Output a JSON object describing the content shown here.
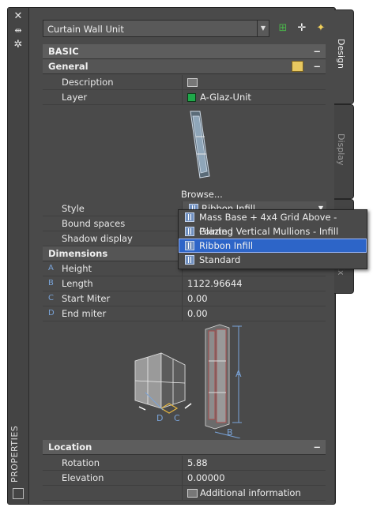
{
  "toolbar": {
    "selected_object": "Curtain Wall Unit"
  },
  "side": {
    "palette_title": "PROPERTIES"
  },
  "tabs": [
    "Design",
    "Display",
    "Ex"
  ],
  "basic": {
    "title": "BASIC",
    "general_title": "General",
    "description_label": "Description",
    "layer_label": "Layer",
    "layer_value": "A-Glaz-Unit",
    "browse_label": "Browse...",
    "style_label": "Style",
    "style_value": "Ribbon Infill",
    "bound_spaces_label": "Bound spaces",
    "shadow_display_label": "Shadow display"
  },
  "dimensions": {
    "title": "Dimensions",
    "rows": [
      {
        "letter": "A",
        "label": "Height",
        "value": ""
      },
      {
        "letter": "B",
        "label": "Length",
        "value": "1122.96644"
      },
      {
        "letter": "C",
        "label": "Start Miter",
        "value": "0.00"
      },
      {
        "letter": "D",
        "label": "End miter",
        "value": "0.00"
      }
    ],
    "diagram_labels": [
      "A",
      "B",
      "C",
      "D"
    ]
  },
  "location": {
    "title": "Location",
    "rotation_label": "Rotation",
    "rotation_value": "5.88",
    "elevation_label": "Elevation",
    "elevation_value": "0.00000",
    "additional_info": "Additional information"
  },
  "style_dropdown": {
    "options": [
      "Mass Base + 4x4 Grid Above - Glazing",
      "Pointed Vertical Mullions - Infill",
      "Ribbon Infill",
      "Standard"
    ],
    "selected": "Ribbon Infill"
  },
  "colors": {
    "layer_swatch": "#1fa84a",
    "selection": "#2d65c8",
    "accent_letter": "#7aa4d9"
  },
  "icons": [
    "close-icon",
    "auto-hide-icon",
    "settings-icon",
    "add-selected-icon",
    "quick-select-icon",
    "select-objects-icon",
    "section-minus-icon"
  ]
}
